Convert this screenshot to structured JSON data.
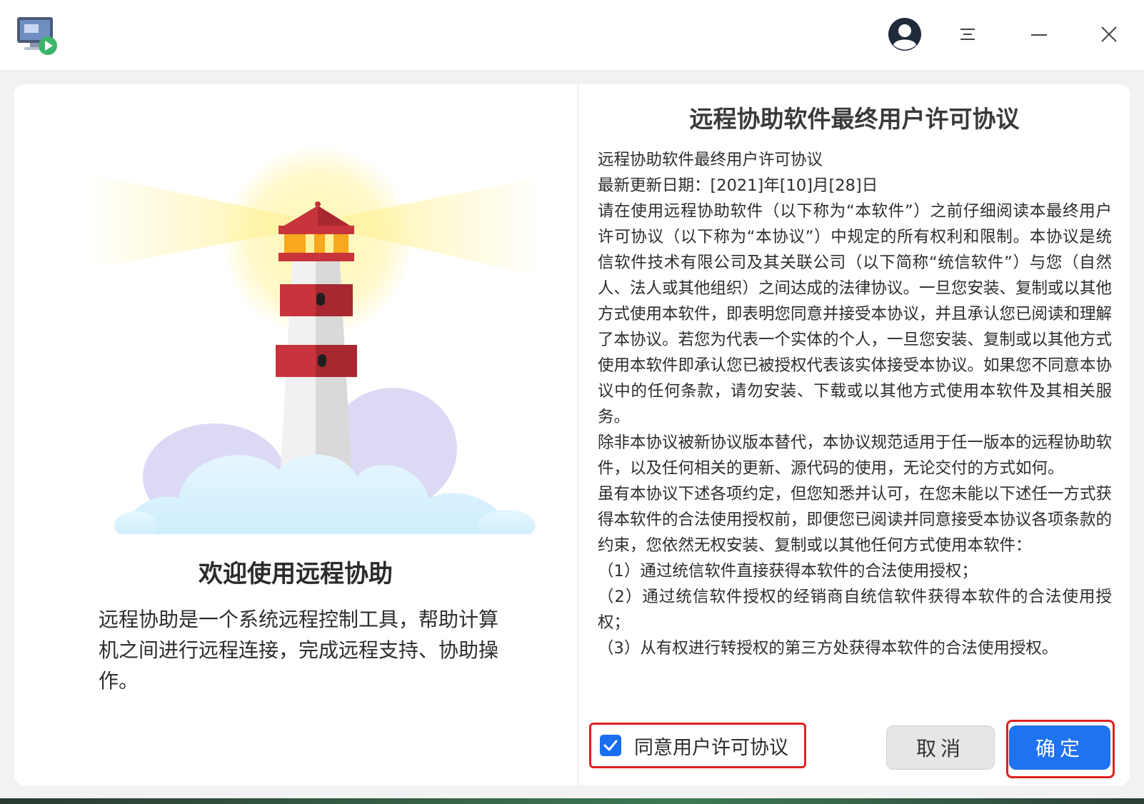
{
  "titlebar": {
    "icons": [
      "remote-assist-app-icon",
      "user-avatar-icon",
      "menu-icon",
      "minimize-icon",
      "close-icon"
    ]
  },
  "welcome": {
    "title": "欢迎使用远程协助",
    "description": "远程协助是一个系统远程控制工具，帮助计算机之间进行远程连接，完成远程支持、协助操作。"
  },
  "license": {
    "title": "远程协助软件最终用户许可协议",
    "paragraphs": [
      "远程协助软件最终用户许可协议",
      "最新更新日期：[2021]年[10]月[28]日",
      "请在使用远程协助软件（以下称为“本软件”）之前仔细阅读本最终用户许可协议（以下称为“本协议”）中规定的所有权利和限制。本协议是统信软件技术有限公司及其关联公司（以下简称“统信软件”）与您（自然人、法人或其他组织）之间达成的法律协议。一旦您安装、复制或以其他方式使用本软件，即表明您同意并接受本协议，并且承认您已阅读和理解了本协议。若您为代表一个实体的个人，一旦您安装、复制或以其他方式使用本软件即承认您已被授权代表该实体接受本协议。如果您不同意本协议中的任何条款，请勿安装、下载或以其他方式使用本软件及其相关服务。",
      "除非本协议被新协议版本替代，本协议规范适用于任一版本的远程协助软件，以及任何相关的更新、源代码的使用，无论交付的方式如何。",
      "虽有本协议下述各项约定，但您知悉并认可，在您未能以下述任一方式获得本软件的合法使用授权前，即便您已阅读并同意接受本协议各项条款的约束，您依然无权安装、复制或以其他任何方式使用本软件：",
      "（1）通过统信软件直接获得本软件的合法使用授权；",
      "（2）通过统信软件授权的经销商自统信软件获得本软件的合法使用授权；",
      "（3）从有权进行转授权的第三方处获得本软件的合法使用授权。"
    ]
  },
  "footer": {
    "agree_label": "同意用户许可协议",
    "agree_checked": true,
    "cancel_label": "取消",
    "confirm_label": "确定"
  },
  "colors": {
    "accent": "#1f72f0",
    "highlight": "#e02020",
    "lighthouse_red": "#c8343c"
  }
}
